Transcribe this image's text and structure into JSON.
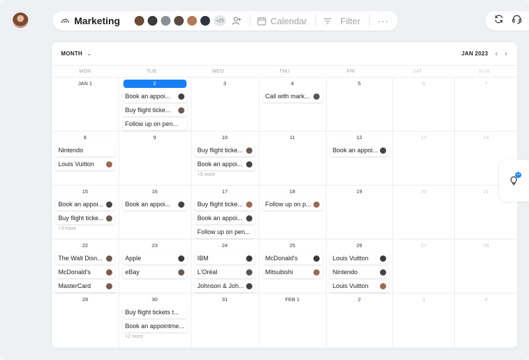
{
  "board": {
    "title": "Marketing",
    "member_count": "+25"
  },
  "members": [
    {
      "color": "#6b4a3a"
    },
    {
      "color": "#3b3b3b"
    },
    {
      "color": "#8a8f96"
    },
    {
      "color": "#5a4a40"
    },
    {
      "color": "#b07a5a"
    },
    {
      "color": "#2f3540"
    }
  ],
  "toolbar": {
    "calendar_label": "Calendar",
    "filter_label": "Filter",
    "more_label": "···"
  },
  "calendar": {
    "view": "MONTH",
    "month_label": "JAN 2023",
    "weekdays": [
      "MON",
      "TUE",
      "WED",
      "THU",
      "FRI",
      "SAT",
      "SUN"
    ],
    "weeks": [
      [
        {
          "day": "JAN 1",
          "events": []
        },
        {
          "day": "2",
          "today": true,
          "events": [
            {
              "label": "Book an appoi...",
              "av": "#444"
            },
            {
              "label": "Buy flight ticke...",
              "av": "#6b5a50"
            },
            {
              "label": "Follow up on pen...",
              "av": null
            }
          ]
        },
        {
          "day": "3",
          "events": []
        },
        {
          "day": "4",
          "events": [
            {
              "label": "Call with mark...",
              "av": "#555"
            }
          ]
        },
        {
          "day": "5",
          "events": []
        },
        {
          "day": "6",
          "dim": true,
          "events": []
        },
        {
          "day": "7",
          "dim": true,
          "events": []
        }
      ],
      [
        {
          "day": "8",
          "events": [
            {
              "label": "Nintendo",
              "av": null
            },
            {
              "label": "Louis Vuitton",
              "av": "#9a6a55"
            }
          ]
        },
        {
          "day": "9",
          "events": []
        },
        {
          "day": "10",
          "events": [
            {
              "label": "Buy flight ticke...",
              "av": "#6b5a50"
            },
            {
              "label": "Book an appoi...",
              "av": "#444"
            }
          ],
          "more": "+5 more"
        },
        {
          "day": "11",
          "events": []
        },
        {
          "day": "12",
          "events": [
            {
              "label": "Book an appoi...",
              "av": "#444"
            }
          ]
        },
        {
          "day": "13",
          "dim": true,
          "events": []
        },
        {
          "day": "14",
          "dim": true,
          "events": []
        }
      ],
      [
        {
          "day": "15",
          "events": [
            {
              "label": "Book an appoi...",
              "av": "#444"
            },
            {
              "label": "Buy flight ticke...",
              "av": "#6b5a50"
            }
          ],
          "more": "+3 more"
        },
        {
          "day": "16",
          "events": [
            {
              "label": "Book an appoi...",
              "av": "#444"
            }
          ]
        },
        {
          "day": "17",
          "events": [
            {
              "label": "Buy flight ticke...",
              "av": "#9a6a55"
            },
            {
              "label": "Book an appoi...",
              "av": "#444"
            },
            {
              "label": "Follow up on pen...",
              "av": null
            }
          ]
        },
        {
          "day": "18",
          "events": [
            {
              "label": "Follow up on p...",
              "av": "#9a6a55"
            }
          ]
        },
        {
          "day": "19",
          "events": []
        },
        {
          "day": "20",
          "dim": true,
          "events": []
        },
        {
          "day": "21",
          "dim": true,
          "events": []
        }
      ],
      [
        {
          "day": "22",
          "events": [
            {
              "label": "The Walt Disn...",
              "av": "#6b5a50"
            },
            {
              "label": "McDonald's",
              "av": "#7a5a4a"
            },
            {
              "label": "MasterCard",
              "av": "#7a5a4a"
            }
          ]
        },
        {
          "day": "23",
          "events": [
            {
              "label": "Apple",
              "av": "#3a3a3a"
            },
            {
              "label": "eBay",
              "av": "#6b5a50"
            }
          ]
        },
        {
          "day": "24",
          "events": [
            {
              "label": "IBM",
              "av": "#3a3a3a"
            },
            {
              "label": "L'Oréal",
              "av": "#555"
            },
            {
              "label": "Johnson & Joh...",
              "av": "#444"
            }
          ]
        },
        {
          "day": "25",
          "events": [
            {
              "label": "McDonald's",
              "av": "#3a3a3a"
            },
            {
              "label": "Mitsubishi",
              "av": "#9a6a55"
            }
          ]
        },
        {
          "day": "26",
          "events": [
            {
              "label": "Louis Vuitton",
              "av": "#3a3a3a"
            },
            {
              "label": "Nintendo",
              "av": "#444"
            },
            {
              "label": "Louis Vuitton",
              "av": "#9a6a55"
            }
          ]
        },
        {
          "day": "27",
          "dim": true,
          "events": []
        },
        {
          "day": "28",
          "dim": true,
          "events": []
        }
      ],
      [
        {
          "day": "29",
          "events": []
        },
        {
          "day": "30",
          "events": [
            {
              "label": "Buy flight tickets t...",
              "av": null
            },
            {
              "label": "Book an appointme...",
              "av": null
            }
          ],
          "more": "+2 more"
        },
        {
          "day": "31",
          "events": []
        },
        {
          "day": "FEB 1",
          "events": []
        },
        {
          "day": "2",
          "events": []
        },
        {
          "day": "3",
          "dim": true,
          "events": []
        },
        {
          "day": "4",
          "dim": true,
          "events": []
        }
      ]
    ]
  },
  "side_panel": {
    "badge": "12"
  },
  "colors": {
    "accent": "#1a7ff5"
  }
}
